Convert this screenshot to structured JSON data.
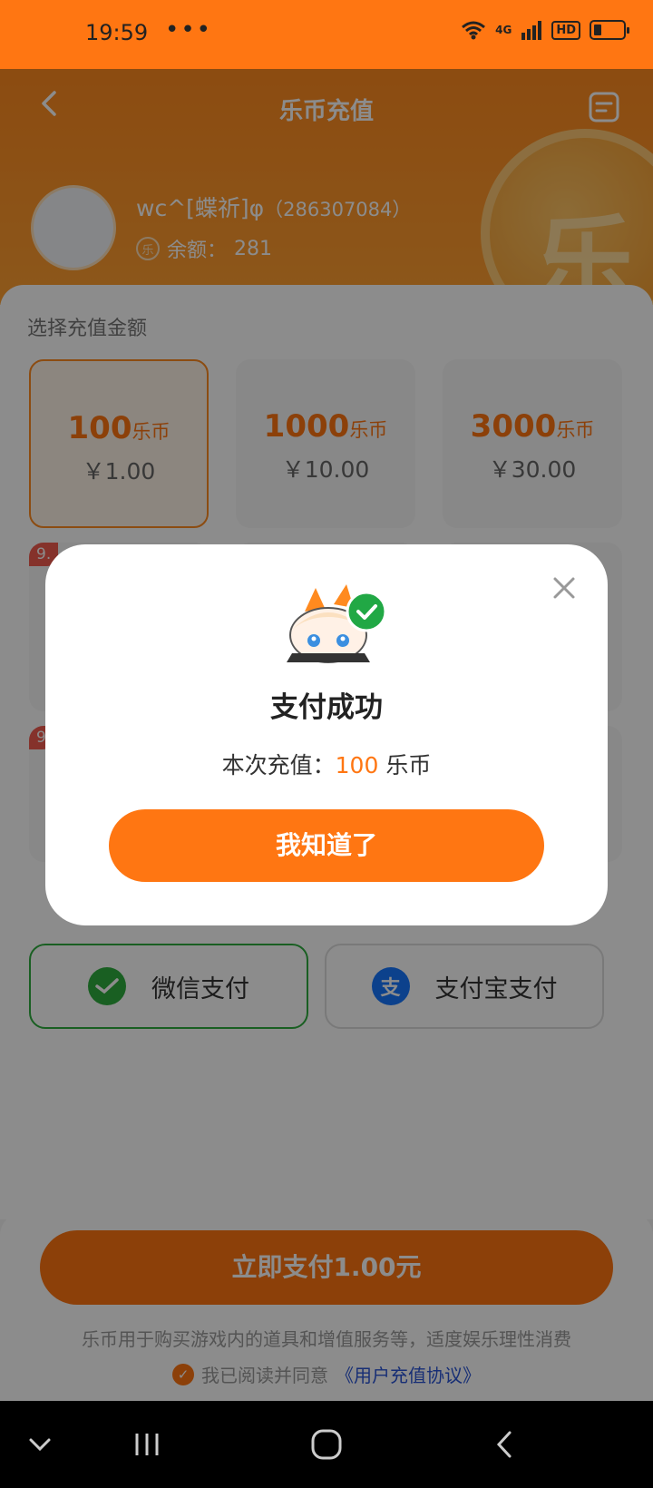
{
  "status_bar": {
    "time": "19:59",
    "dots": "•••",
    "network": "4G",
    "hd": "HD"
  },
  "header": {
    "title": "乐币充值",
    "username": "wc^[蝶祈]φ",
    "uid": "（286307084）",
    "balance_icon": "乐",
    "balance_label": "余额：",
    "balance_value": "281",
    "coin_glyph": "乐"
  },
  "recharge": {
    "section_label": "选择充值金额",
    "options": [
      {
        "coins": "100",
        "unit": "乐币",
        "price": "￥1.00"
      },
      {
        "coins": "1000",
        "unit": "乐币",
        "price": "￥10.00"
      },
      {
        "coins": "3000",
        "unit": "乐币",
        "price": "￥30.00"
      }
    ],
    "badge_1": "9.",
    "badge_2": "9"
  },
  "payment": {
    "wechat_label": "微信支付",
    "alipay_label": "支付宝支付",
    "alipay_glyph": "支"
  },
  "bottom": {
    "pay_button": "立即支付1.00元",
    "notice": "乐币用于购买游戏内的道具和增值服务等，适度娱乐理性消费",
    "agree_prefix": "我已阅读并同意",
    "agree_link": "《用户充值协议》"
  },
  "modal": {
    "title": "支付成功",
    "text_prefix": "本次充值：",
    "amount": "100",
    "text_suffix": "乐币",
    "ok_button": "我知道了"
  },
  "colors": {
    "accent": "#ff7612",
    "wechat": "#2fae3e",
    "alipay": "#1677ff",
    "success": "#21a845"
  }
}
